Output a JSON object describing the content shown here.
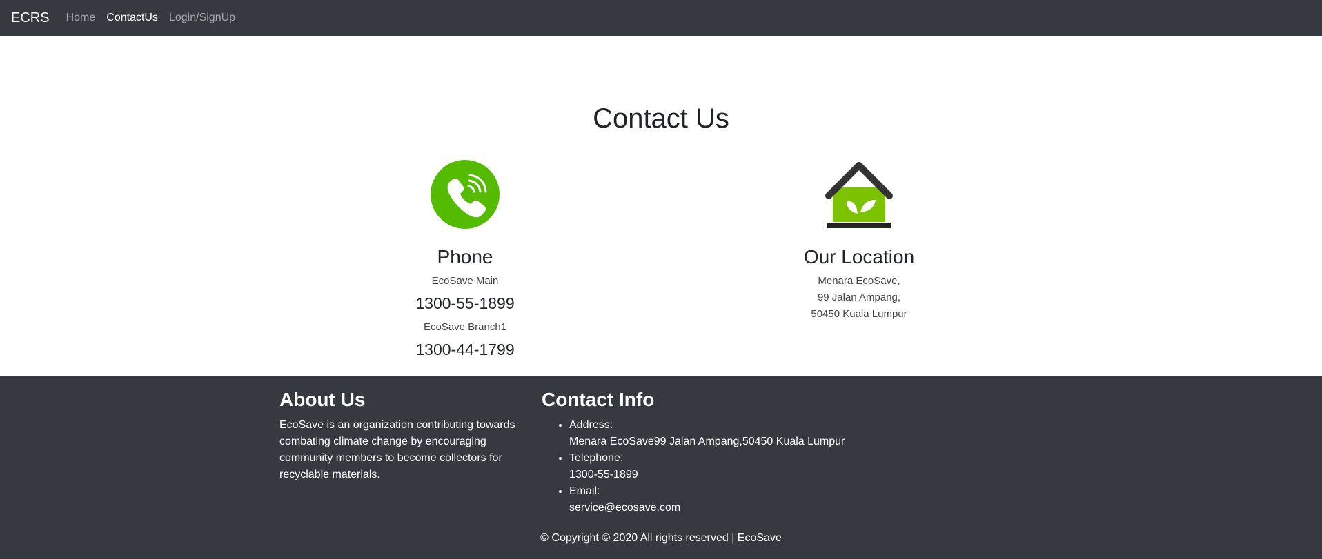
{
  "navbar": {
    "brand": "ECRS",
    "links": [
      {
        "label": "Home"
      },
      {
        "label": "ContactUs"
      },
      {
        "label": "Login/SignUp"
      }
    ]
  },
  "main": {
    "title": "Contact Us",
    "phone": {
      "heading": "Phone",
      "entries": [
        {
          "name": "EcoSave Main",
          "number": "1300-55-1899"
        },
        {
          "name": "EcoSave Branch1",
          "number": "1300-44-1799"
        }
      ]
    },
    "location": {
      "heading": "Our Location",
      "lines": [
        "Menara EcoSave,",
        "99 Jalan Ampang,",
        "50450 Kuala Lumpur"
      ]
    }
  },
  "footer": {
    "about": {
      "heading": "About Us",
      "text": "EcoSave is an organization contributing towards combating climate change by encouraging community members to become collectors for recyclable materials."
    },
    "contact": {
      "heading": "Contact Info",
      "items": [
        {
          "label": "Address:",
          "value": "Menara EcoSave99 Jalan Ampang,50450 Kuala Lumpur"
        },
        {
          "label": "Telephone:",
          "value": "1300-55-1899"
        },
        {
          "label": "Email:",
          "value": "service@ecosave.com"
        }
      ]
    },
    "copyright": "© Copyright © 2020 All rights reserved | EcoSave"
  },
  "colors": {
    "navbar_bg": "#343a40",
    "footer_bg": "#343a40",
    "phone_icon_green": "#55bb00",
    "house_green": "#7cc200"
  },
  "icons": {
    "phone": "phone-icon",
    "location": "house-leaf-icon"
  }
}
